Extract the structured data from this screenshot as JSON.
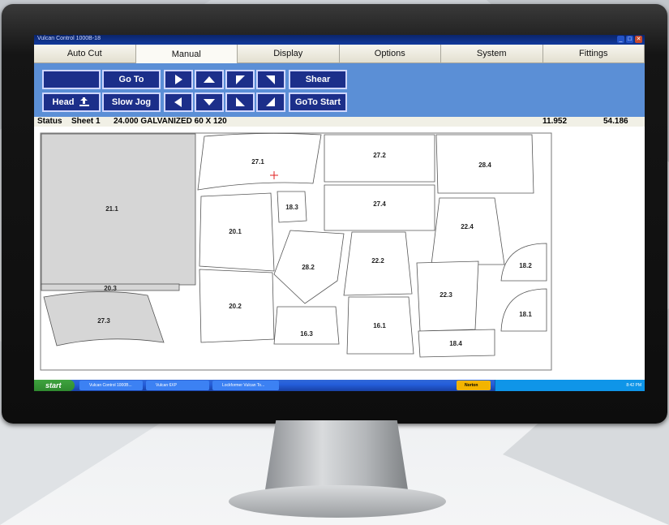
{
  "window": {
    "title": "Vulcan Control 1000B-18"
  },
  "tabs": [
    {
      "label": "Auto Cut"
    },
    {
      "label": "Manual"
    },
    {
      "label": "Display"
    },
    {
      "label": "Options"
    },
    {
      "label": "System"
    },
    {
      "label": "Fittings"
    }
  ],
  "active_tab": "Manual",
  "toolbar": {
    "goto_label": "Go To",
    "shear_label": "Shear",
    "head_label": "Head",
    "slow_jog_label": "Slow Jog",
    "goto_start_label": "GoTo Start"
  },
  "status": {
    "label": "Status",
    "sheet": "Sheet 1",
    "material": "24.000 GALVANIZED 60 X 120",
    "x": "11.952",
    "y": "54.186"
  },
  "parts": [
    {
      "label": "21.1"
    },
    {
      "label": "20.3"
    },
    {
      "label": "27.3"
    },
    {
      "label": "27.1"
    },
    {
      "label": "18.3"
    },
    {
      "label": "20.1"
    },
    {
      "label": "20.2"
    },
    {
      "label": "28.2"
    },
    {
      "label": "16.3"
    },
    {
      "label": "27.2"
    },
    {
      "label": "27.4"
    },
    {
      "label": "22.2"
    },
    {
      "label": "16.1"
    },
    {
      "label": "28.4"
    },
    {
      "label": "22.4"
    },
    {
      "label": "22.3"
    },
    {
      "label": "18.4"
    },
    {
      "label": "18.2"
    },
    {
      "label": "18.1"
    }
  ],
  "taskbar": {
    "start_label": "start",
    "tasks": [
      {
        "label": "Vulcan Control 1000B..."
      },
      {
        "label": "Vulcan 6XP"
      },
      {
        "label": "Lockformer Vulcan To..."
      }
    ],
    "norton_label": "Norton",
    "clock": "8:42 PM"
  },
  "colors": {
    "toolbar_bg": "#5b8fd6",
    "button_bg": "#1c2f8a",
    "titlebar": "#0a246a",
    "remnant_gray": "#d6d6d6"
  }
}
